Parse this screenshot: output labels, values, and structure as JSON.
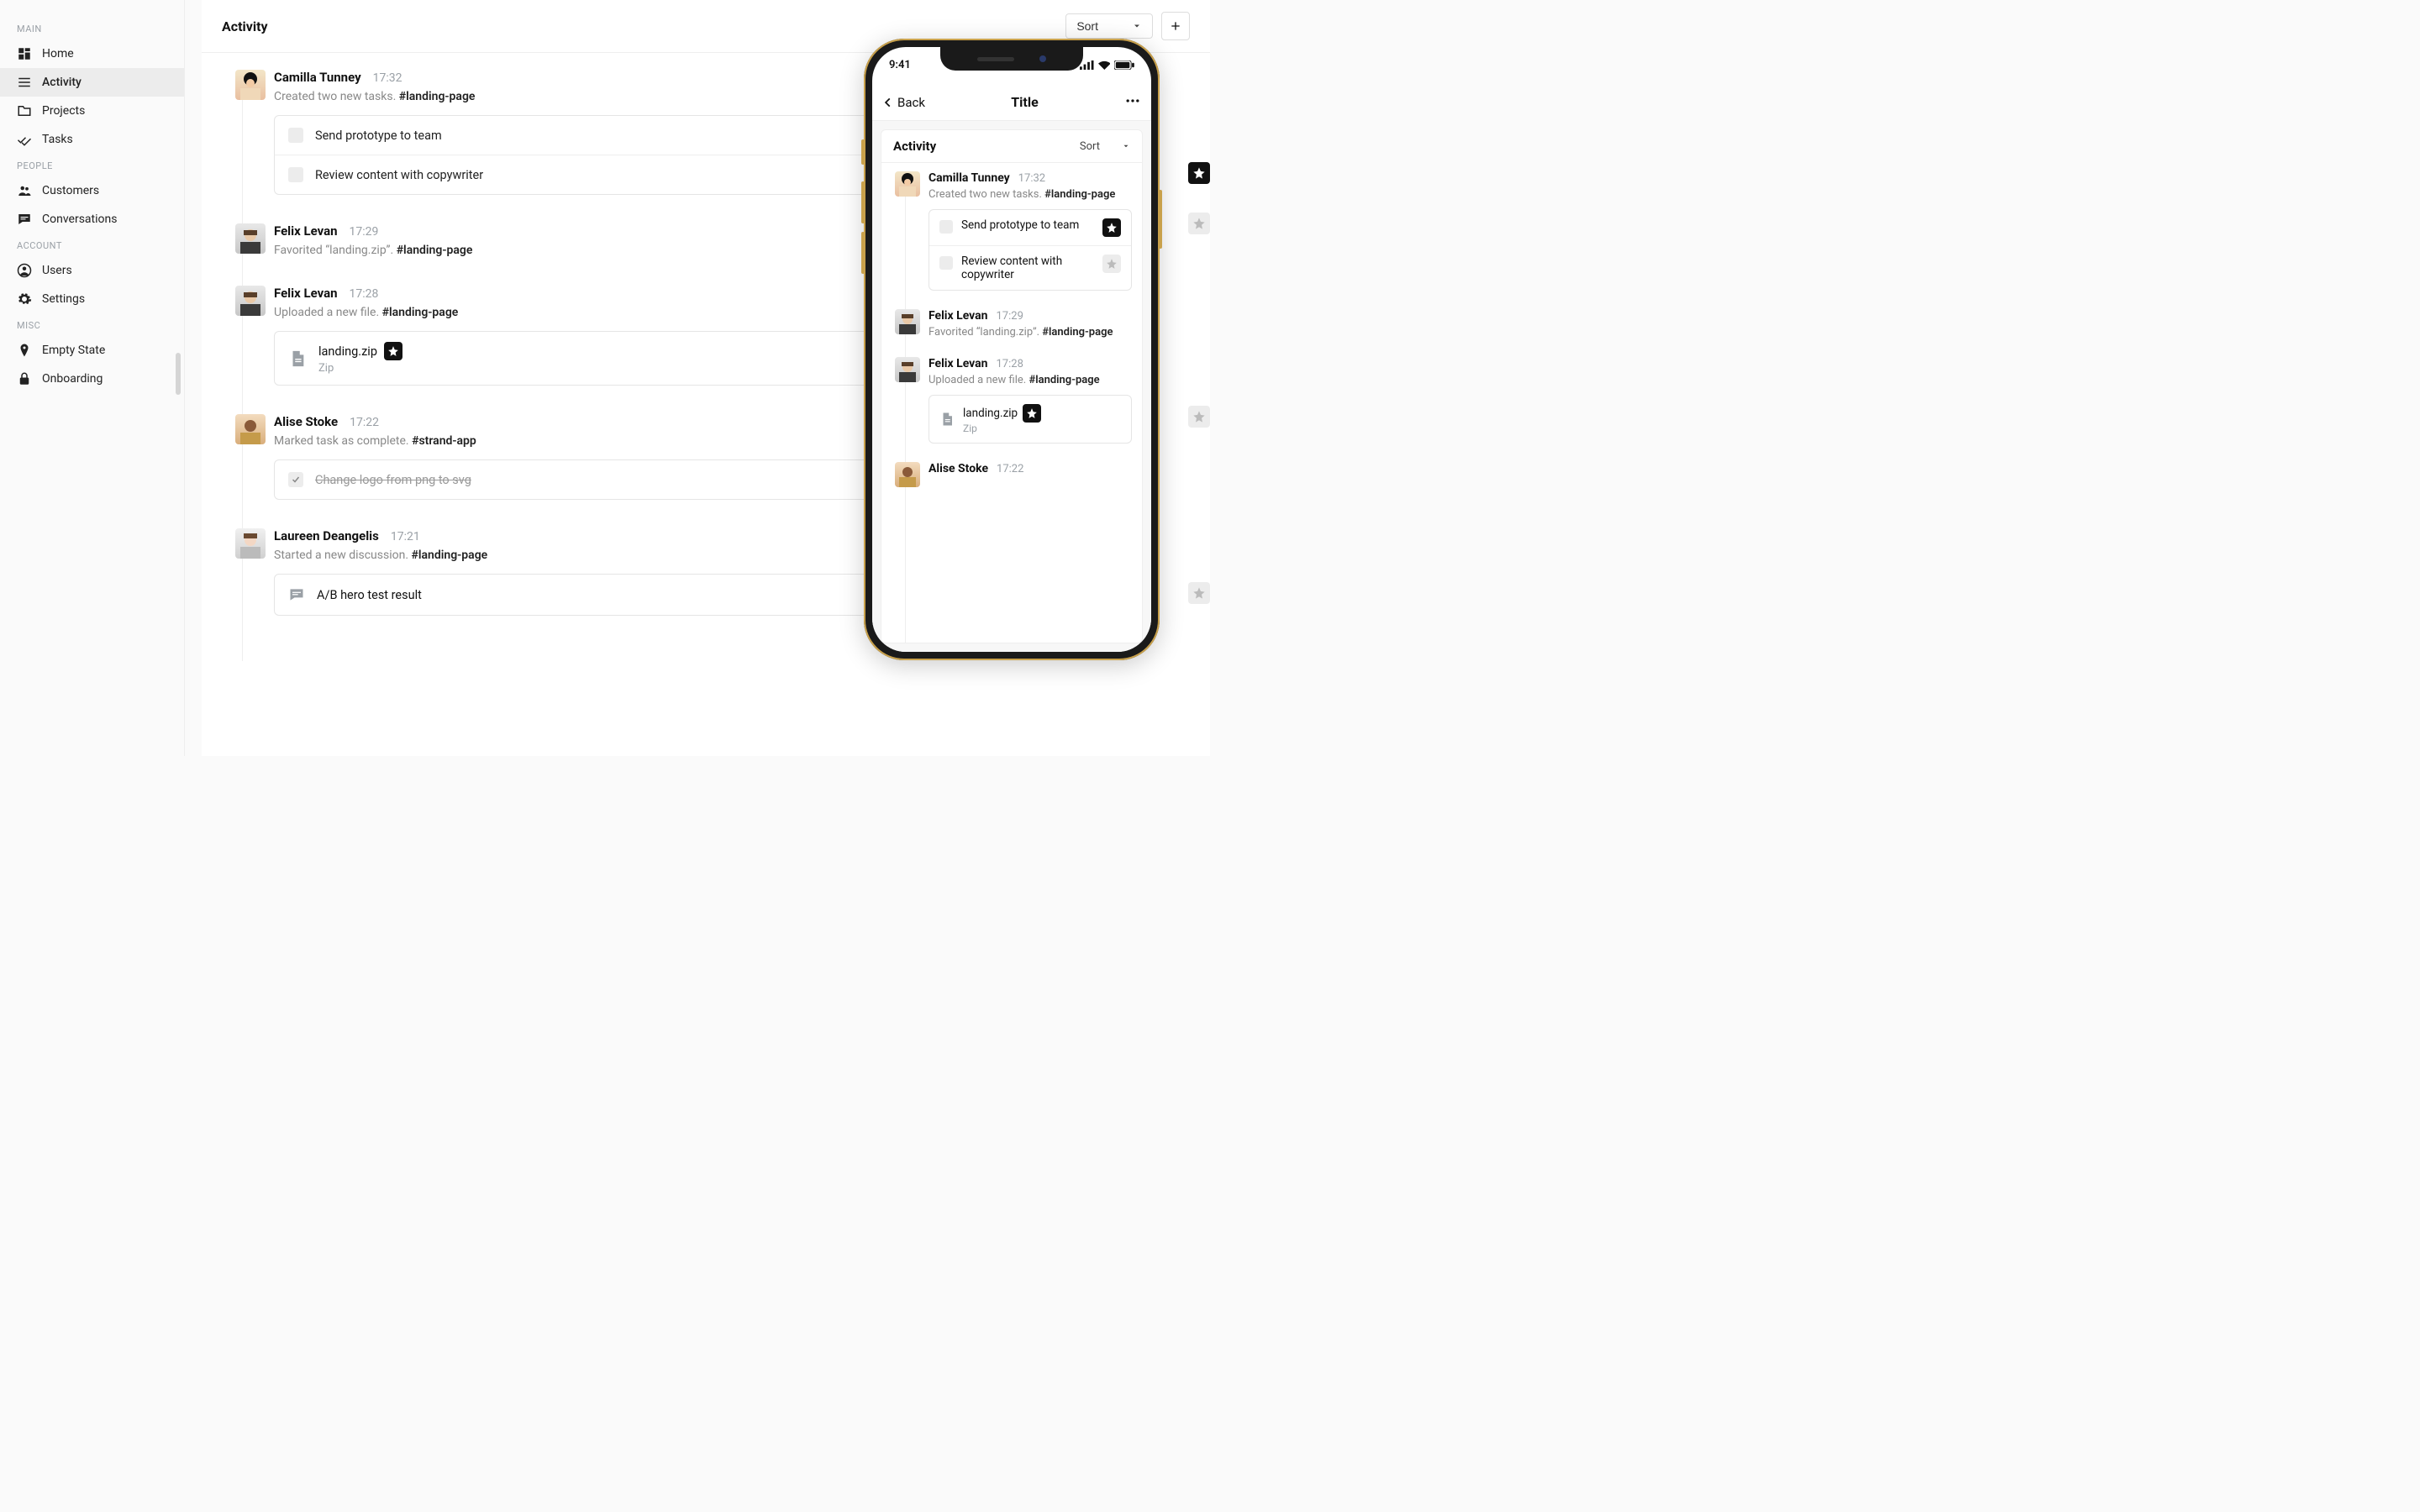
{
  "sidebar": {
    "groups": [
      {
        "title": "MAIN",
        "items": [
          {
            "label": "Home"
          },
          {
            "label": "Activity"
          },
          {
            "label": "Projects"
          },
          {
            "label": "Tasks"
          }
        ]
      },
      {
        "title": "PEOPLE",
        "items": [
          {
            "label": "Customers"
          },
          {
            "label": "Conversations"
          }
        ]
      },
      {
        "title": "ACCOUNT",
        "items": [
          {
            "label": "Users"
          },
          {
            "label": "Settings"
          }
        ]
      },
      {
        "title": "MISC",
        "items": [
          {
            "label": "Empty State"
          },
          {
            "label": "Onboarding"
          }
        ]
      }
    ]
  },
  "main": {
    "title": "Activity",
    "sort_label": "Sort",
    "feed": [
      {
        "name": "Camilla Tunney",
        "time": "17:32",
        "action": "Created two new tasks.",
        "tag": "#landing-page",
        "tasks": [
          {
            "label": "Send prototype to team",
            "done": false
          },
          {
            "label": "Review content with copywriter",
            "done": false
          }
        ]
      },
      {
        "name": "Felix Levan",
        "time": "17:29",
        "action": "Favorited “landing.zip”.",
        "tag": "#landing-page"
      },
      {
        "name": "Felix Levan",
        "time": "17:28",
        "action": "Uploaded a new file.",
        "tag": "#landing-page",
        "file": {
          "name": "landing.zip",
          "kind": "Zip",
          "starred": true
        }
      },
      {
        "name": "Alise Stoke",
        "time": "17:22",
        "action": "Marked task as complete.",
        "tag": "#strand-app",
        "tasks": [
          {
            "label": "Change logo from png to svg",
            "done": true
          }
        ]
      },
      {
        "name": "Laureen Deangelis",
        "time": "17:21",
        "action": "Started a new discussion.",
        "tag": "#landing-page",
        "discussion": {
          "title": "A/B hero test result"
        }
      }
    ]
  },
  "phone": {
    "status_time": "9:41",
    "nav": {
      "back": "Back",
      "title": "Title"
    },
    "panel_title": "Activity",
    "sort_label": "Sort",
    "feed": [
      {
        "name": "Camilla Tunney",
        "time": "17:32",
        "action": "Created two new tasks.",
        "tag": "#landing-page",
        "tasks": [
          {
            "label": "Send prototype to team",
            "star": "solid"
          },
          {
            "label": "Review content with copywriter",
            "star": "ghost"
          }
        ]
      },
      {
        "name": "Felix Levan",
        "time": "17:29",
        "action": "Favorited “landing.zip”.",
        "tag": "#landing-page"
      },
      {
        "name": "Felix Levan",
        "time": "17:28",
        "action": "Uploaded a new file.",
        "tag": "#landing-page",
        "file": {
          "name": "landing.zip",
          "kind": "Zip",
          "starred": true
        }
      },
      {
        "name": "Alise Stoke",
        "time": "17:22"
      }
    ]
  }
}
